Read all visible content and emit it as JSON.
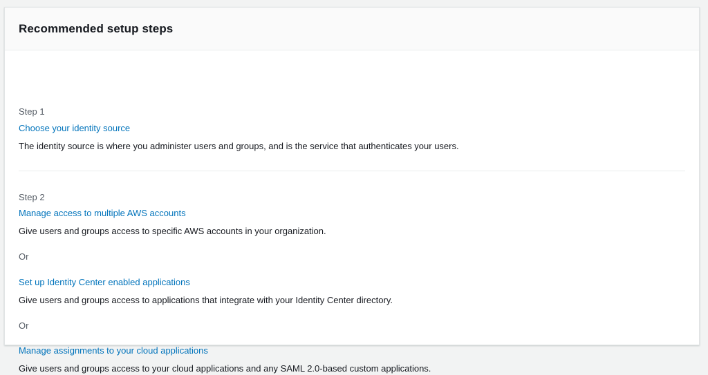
{
  "panel": {
    "title": "Recommended setup steps"
  },
  "step1": {
    "label": "Step 1",
    "link": "Choose your identity source",
    "description": "The identity source is where you administer users and groups, and is the service that authenticates your users."
  },
  "step2": {
    "label": "Step 2",
    "options": [
      {
        "link": "Manage access to multiple AWS accounts",
        "description": "Give users and groups access to specific AWS accounts in your organization."
      },
      {
        "link": "Set up Identity Center enabled applications",
        "description": "Give users and groups access to applications that integrate with your Identity Center directory."
      },
      {
        "link": "Manage assignments to your cloud applications",
        "description": "Give users and groups access to your cloud applications and any SAML 2.0-based custom applications."
      }
    ],
    "or_label": "Or"
  },
  "colors": {
    "link": "#0073bb",
    "text": "#16191f",
    "muted": "#545b64",
    "header_bg": "#fafafa"
  }
}
